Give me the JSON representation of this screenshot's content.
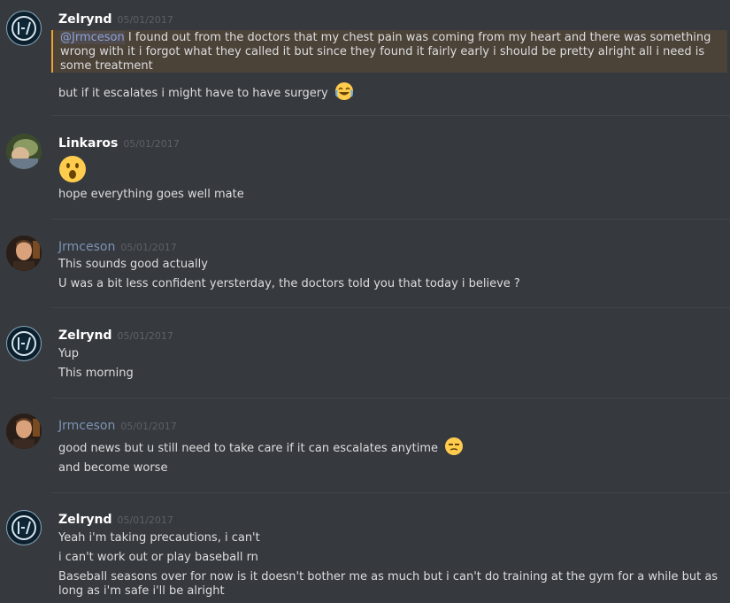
{
  "messages": [
    {
      "author": "Zelrynd",
      "timestamp": "05/01/2017",
      "mention": "@Jrmceson",
      "line1": " I found out from the doctors that my chest pain was coming from my heart and there was something wrong with it i forgot what they called it but since they found it fairly early i should be pretty alright all i need is some treatment",
      "line2": "but if it escalates i might have to have surgery",
      "emoji": "joy-emoji"
    },
    {
      "author": "Linkaros",
      "timestamp": "05/01/2017",
      "emoji": "open-mouth-emoji",
      "line1": "hope everything goes well mate"
    },
    {
      "author": "Jrmceson",
      "timestamp": "05/01/2017",
      "line1": "This sounds good actually",
      "line2": "U was a bit less confident yersterday,  the doctors told you that today i believe ?"
    },
    {
      "author": "Zelrynd",
      "timestamp": "05/01/2017",
      "line1": "Yup",
      "line2": "This morning"
    },
    {
      "author": "Jrmceson",
      "timestamp": "05/01/2017",
      "line1": "good news but u still need to take care if it can escalates anytime",
      "emoji": "unamused-emoji",
      "line2": "and become worse"
    },
    {
      "author": "Zelrynd",
      "timestamp": "05/01/2017",
      "line1": "Yeah i'm taking precautions, i can't",
      "line2": "i can't work out or play baseball rn",
      "line3": "Baseball seasons over for now is it doesn't bother me as much but i can't do training at the gym for a while but as long as i'm safe i'll be alright"
    }
  ],
  "colors": {
    "background": "#36393e",
    "mention_highlight": "#4b4238",
    "mention_border": "#f0a232",
    "mention_link": "#8ba1d9",
    "jrmceson_name": "#7d93b4"
  }
}
